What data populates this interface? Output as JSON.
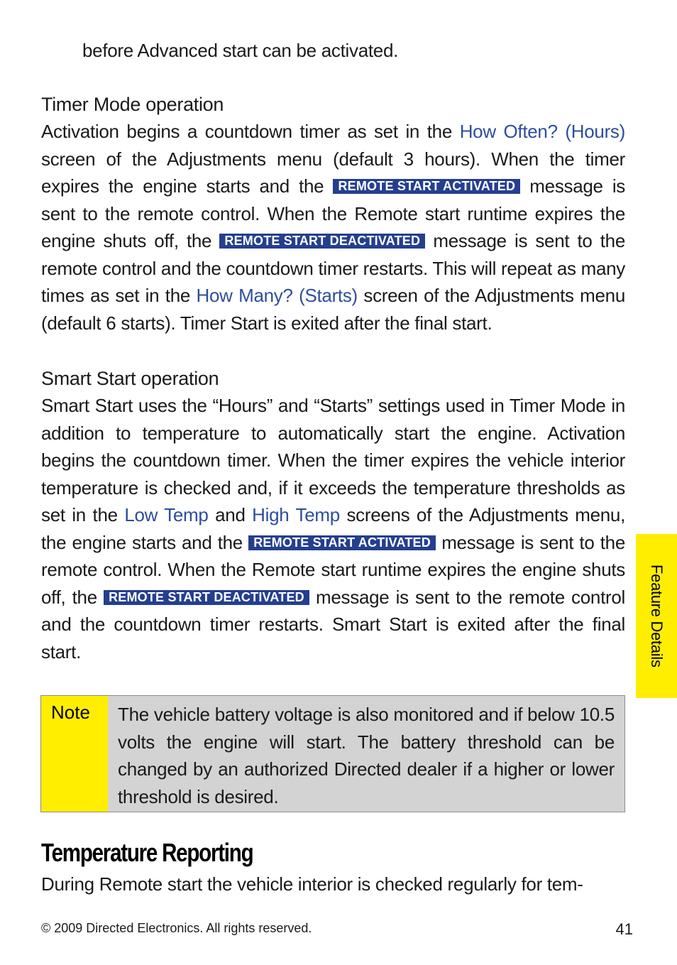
{
  "intro_line": "before Advanced start can be activated.",
  "timer_mode": {
    "heading": "Timer Mode operation",
    "p1": "Activation begins a countdown timer as set in the ",
    "link1": "How Often? (Hours)",
    "p2": " screen of the Adjustments menu (default 3 hours). When the timer expires the engine starts and the ",
    "badge1": "REMOTE START ACTIVATED",
    "p3": " message is sent to the remote control. When the Remote start runtime expires the engine shuts off, the ",
    "badge2": "REMOTE START DEACTIVATED",
    "p4": " message is sent to the remote control and the countdown timer restarts. This will repeat as many times as set in the ",
    "link2": "How Many? (Starts)",
    "p5": " screen of the Adjustments menu (default 6 starts). Timer Start is exited after the final start."
  },
  "smart_start": {
    "heading": "Smart Start operation",
    "p1": "Smart Start uses the “Hours” and “Starts” settings used in Timer Mode in addition to temperature to automatically start the engine. Activation begins the countdown timer. When the timer expires the vehicle inte­rior temperature is checked and, if it exceeds the temperature thresh­olds as set in the ",
    "link1": "Low Temp",
    "p2": " and ",
    "link2": "High Temp",
    "p3": " screens of the Adjustments menu, the engine starts and the ",
    "badge1": "REMOTE START ACTIVATED",
    "p4": " message is sent to the remote control. When the Remote start runtime expires the engine shuts off, the ",
    "badge2": "REMOTE START DEACTIVATED",
    "p5": " message is sent to the remote control and the countdown timer restarts. Smart Start is exited after the final start."
  },
  "note": {
    "label": "Note",
    "text": "The vehicle battery voltage is also monitored and if below 10.5 volts the engine will start. The battery threshold can be changed by an authorized Directed dealer if a higher or lower threshold is desired."
  },
  "side_tab": "Feature Details",
  "temperature_reporting": {
    "title": "Temperature Reporting",
    "text": "During Remote start the vehicle interior is checked regularly for tem-"
  },
  "footer": {
    "copyright": "© 2009 Directed Electronics. All rights reserved.",
    "page_number": "41"
  },
  "colors": {
    "link": "#2e4d9c",
    "badge_bg": "#243f8f",
    "highlight_yellow": "#ffee00",
    "note_bg": "#d3d3d3"
  }
}
